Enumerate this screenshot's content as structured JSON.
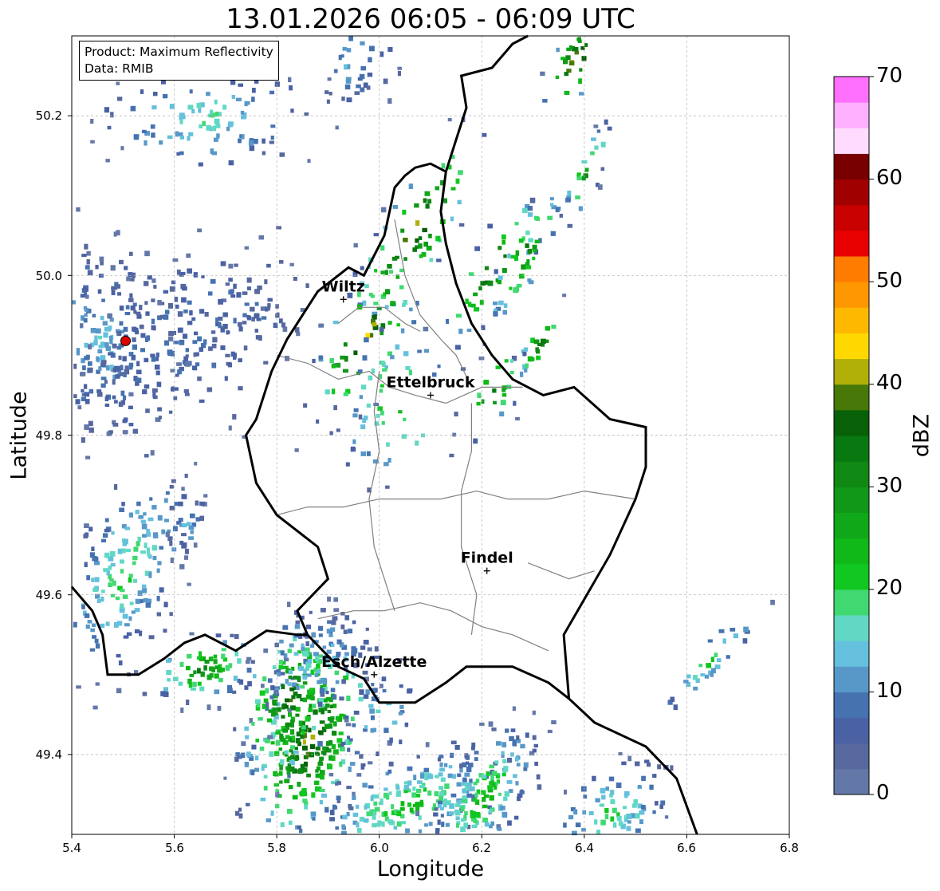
{
  "title": "13.01.2026 06:05 - 06:09 UTC",
  "info": {
    "product": "Product: Maximum Reflectivity",
    "data_source": "Data: RMIB"
  },
  "axes": {
    "xlabel": "Longitude",
    "ylabel": "Latitude",
    "xlim": [
      5.4,
      6.8
    ],
    "ylim": [
      49.3,
      50.3
    ],
    "xticks": [
      "5.4",
      "5.6",
      "5.8",
      "6.0",
      "6.2",
      "6.4",
      "6.6",
      "6.8"
    ],
    "yticks": [
      "49.4",
      "49.6",
      "49.8",
      "50.0",
      "50.2"
    ],
    "grid": true
  },
  "colorbar": {
    "label": "dBZ",
    "ticks": [
      "70",
      "60",
      "50",
      "40",
      "30",
      "20",
      "10",
      "0"
    ],
    "range": [
      0,
      70
    ],
    "step": 2.5,
    "colors": [
      "#6478a8",
      "#56689e",
      "#4a62a4",
      "#4672b0",
      "#5898c8",
      "#64c0dc",
      "#60d8c4",
      "#40d870",
      "#10c820",
      "#10b818",
      "#10a818",
      "#109818",
      "#108814",
      "#087810",
      "#086008",
      "#487808",
      "#b0b008",
      "#ffd800",
      "#ffb800",
      "#ff9800",
      "#ff7c00",
      "#e80000",
      "#c80000",
      "#a00000",
      "#780000",
      "#ffdcff",
      "#ffb0ff",
      "#ff70ff",
      "#ec38ec"
    ]
  },
  "cities": [
    {
      "name": "Wiltz",
      "lon": 5.93,
      "lat": 49.97
    },
    {
      "name": "Ettelbruck",
      "lon": 6.1,
      "lat": 49.85
    },
    {
      "name": "Findel",
      "lon": 6.21,
      "lat": 49.63
    },
    {
      "name": "Esch/Alzette",
      "lon": 5.99,
      "lat": 49.5
    }
  ],
  "radar_site": {
    "lon": 5.505,
    "lat": 49.918,
    "color": "#dd0000"
  },
  "map_colors": {
    "border": "#000000",
    "cantons": "#808080",
    "grid": "#b0b0b0"
  }
}
